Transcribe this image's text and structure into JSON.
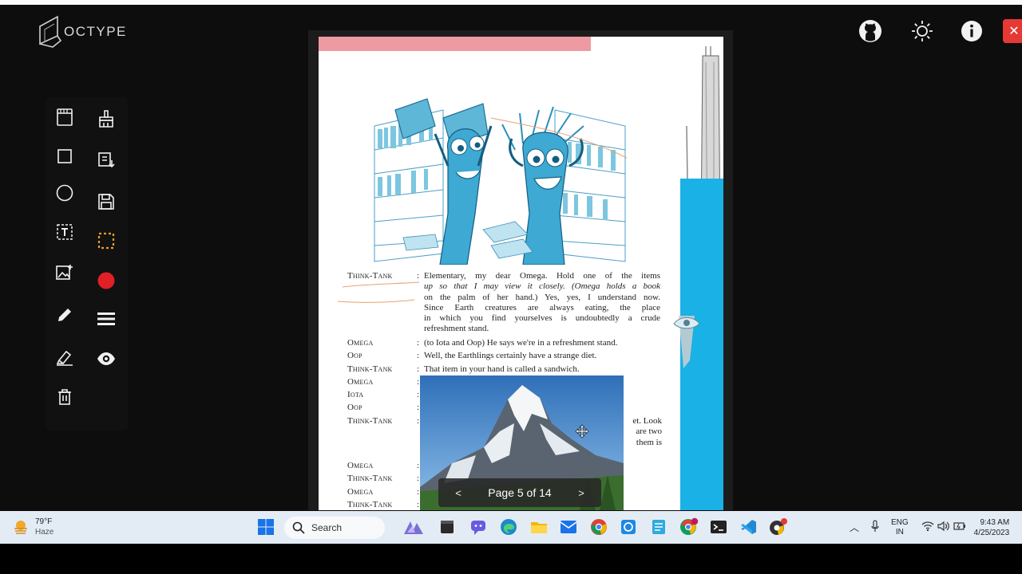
{
  "app": {
    "logo_text": "OCTYPE"
  },
  "colors": {
    "accent_red": "#e53935",
    "record_dot": "#e01f26",
    "cyan_band": "#19b1e6",
    "pink_bar": "#ee9aa2"
  },
  "top_icons": [
    "github-icon",
    "sun-icon",
    "info-icon",
    "close-icon"
  ],
  "toolbar": {
    "tools_left": [
      "document-icon",
      "square-icon",
      "circle-icon",
      "text-box-icon",
      "add-image-icon",
      "pencil-icon",
      "highlighter-icon",
      "trash-icon"
    ],
    "tools_right": [
      "eraser-brush-icon",
      "import-icon",
      "save-icon",
      "selection-icon",
      "color-dot",
      "line-weight-icon",
      "eye-icon"
    ]
  },
  "document": {
    "script": [
      {
        "speaker": "Think-Tank",
        "lines": [
          "Elementary, my dear Omega. Hold one of the items",
          "up so that I may view it closely. (Omega holds a book",
          "on the palm of her hand.) Yes, yes, I understand now.",
          "Since Earth creatures are always eating, the place",
          "in which you find yourselves is undoubtedly a crude",
          "refreshment stand."
        ]
      },
      {
        "speaker": "Omega",
        "lines": [
          "(to Iota and Oop) He says we're in a refreshment stand."
        ]
      },
      {
        "speaker": "Oop",
        "lines": [
          "Well, the Earthlings certainly have a strange diet."
        ]
      },
      {
        "speaker": "Think-Tank",
        "lines": [
          "That item in your hand is called a sandwich."
        ]
      },
      {
        "speaker": "Omega",
        "lines": [
          ""
        ]
      },
      {
        "speaker": "Iota",
        "lines": [
          ""
        ]
      },
      {
        "speaker": "Oop",
        "lines": [
          ""
        ]
      },
      {
        "speaker": "Think-Tank",
        "lines": [
          "et. Look",
          "are two",
          "them is"
        ]
      },
      {
        "speaker": "Omega",
        "lines": [
          ""
        ]
      },
      {
        "speaker": "Think-Tank",
        "lines": [
          ""
        ]
      },
      {
        "speaker": "Omega",
        "lines": [
          ""
        ]
      },
      {
        "speaker": "Think-Tank",
        "lines": [
          ""
        ]
      }
    ]
  },
  "pager": {
    "prev_label": "<",
    "label": "Page 5 of 14",
    "next_label": ">"
  },
  "taskbar": {
    "weather_temp": "79°F",
    "weather_desc": "Haze",
    "search_label": "Search",
    "apps": [
      "windows-start-icon",
      "widget-icon",
      "terminal-icon",
      "chat-icon",
      "edge-icon",
      "file-explorer-icon",
      "mail-icon",
      "chrome-icon",
      "snipping-tool-icon",
      "notepad-icon",
      "chrome-profile-icon",
      "console-icon",
      "vscode-icon",
      "app-icon"
    ],
    "lang_top": "ENG",
    "lang_bottom": "IN",
    "time": "9:43 AM",
    "date": "4/25/2023"
  }
}
